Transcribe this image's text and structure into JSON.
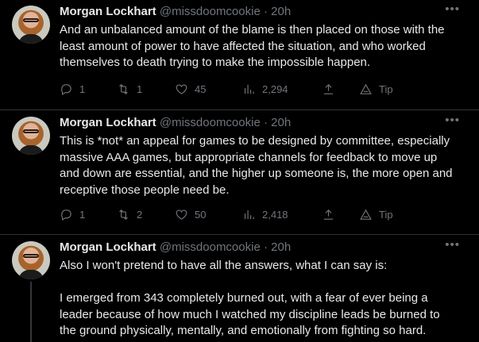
{
  "tweets": [
    {
      "name": "Morgan Lockhart",
      "handle": "@missdoomcookie",
      "time": "20h",
      "text": "And an unbalanced amount of the blame is then placed on those with the least amount of power to have affected the situation, and who worked themselves to death trying to make the impossible happen.",
      "replies": "1",
      "retweets": "1",
      "likes": "45",
      "views": "2,294",
      "tip": "Tip"
    },
    {
      "name": "Morgan Lockhart",
      "handle": "@missdoomcookie",
      "time": "20h",
      "text": "This is *not* an appeal for games to be designed by committee, especially massive AAA games, but appropriate channels for feedback to move up and down are essential, and the higher up someone is, the more open and receptive those people need be.",
      "replies": "1",
      "retweets": "2",
      "likes": "50",
      "views": "2,418",
      "tip": "Tip"
    },
    {
      "name": "Morgan Lockhart",
      "handle": "@missdoomcookie",
      "time": "20h",
      "text": "Also I won't pretend to have all the answers, what I can say is:\n\nI emerged from 343 completely burned out, with a fear of ever being a leader because of how much I watched my discipline leads be burned to the ground physically, mentally, and emotionally from fighting so hard."
    }
  ],
  "icons": {
    "reply": "reply-icon",
    "retweet": "retweet-icon",
    "like": "heart-icon",
    "views": "views-icon",
    "share": "share-icon",
    "tip": "tip-icon",
    "more": "more-icon"
  },
  "colors": {
    "background": "#000000",
    "text": "#e7e9ea",
    "secondary": "#71767b",
    "border": "#2f3336"
  }
}
